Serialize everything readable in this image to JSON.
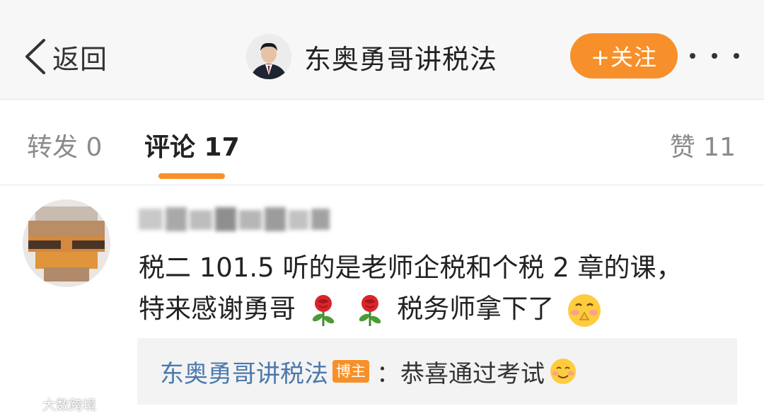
{
  "nav": {
    "back_label": "返回",
    "account_name": "东奥勇哥讲税法",
    "follow_label": "+关注"
  },
  "tabs": {
    "forward_label": "转发 0",
    "comment_label": "评论 17",
    "like_label": "赞 11"
  },
  "comment": {
    "line1": "税二 101.5 听的是老师企税和个税 2 章的课，",
    "line2_before": "特来感谢勇哥",
    "line2_after": "税务师拿下了"
  },
  "reply": {
    "author": "东奥勇哥讲税法",
    "badge": "博主",
    "text": "：恭喜通过考试"
  },
  "watermark": "大数跨境",
  "colors": {
    "accent": "#f7902a",
    "link": "#4b79ad",
    "nav_bg": "#f7f7f7",
    "reply_bg": "#f3f3f3"
  }
}
